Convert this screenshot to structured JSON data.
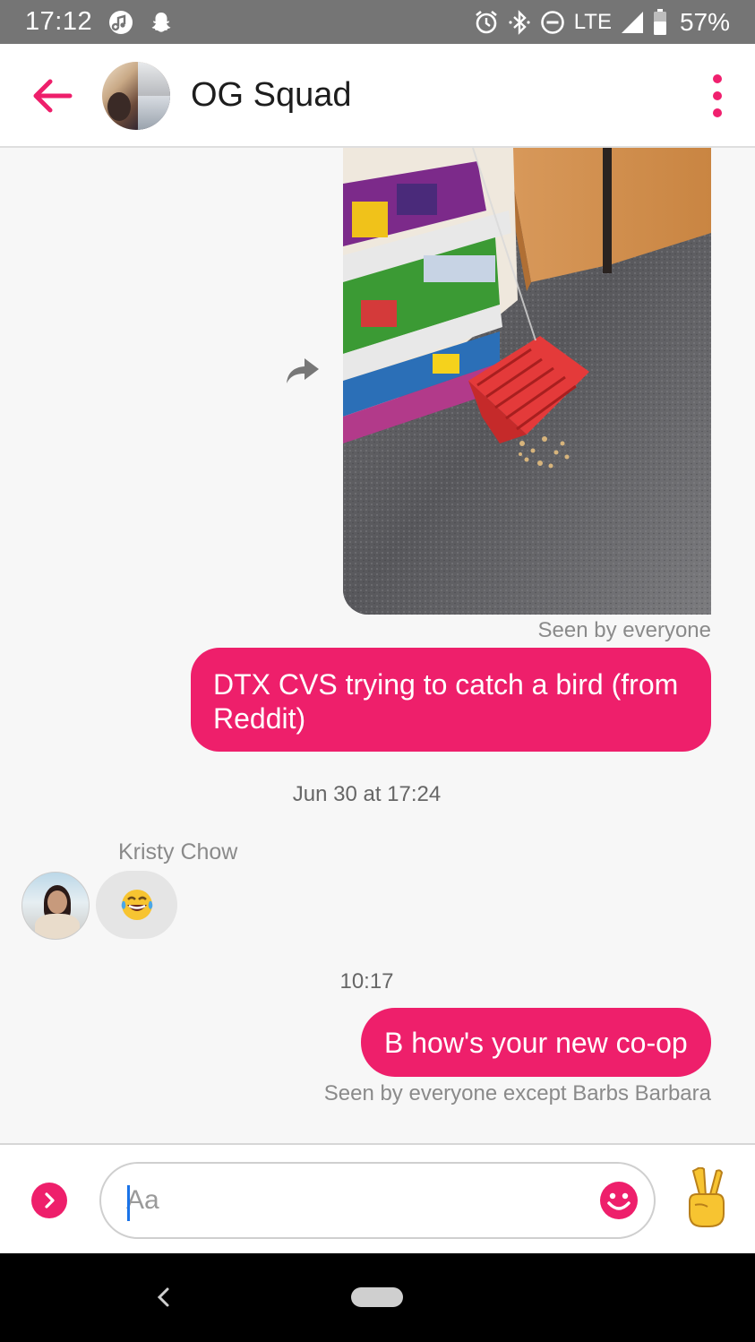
{
  "status_bar": {
    "time": "17:12",
    "network": "LTE",
    "battery": "57%",
    "icons": [
      "music-icon",
      "snapchat-icon",
      "alarm-icon",
      "bluetooth-icon",
      "do-not-disturb-icon",
      "signal-icon",
      "battery-icon"
    ]
  },
  "header": {
    "title": "OG Squad",
    "back_icon": "arrow-left-icon",
    "menu_icon": "more-vertical-icon"
  },
  "messages": {
    "photo_seen": "Seen by everyone",
    "bubble1": "DTX CVS trying to catch a bird (from Reddit)",
    "timestamp1": "Jun 30 at 17:24",
    "sender_name": "Kristy Chow",
    "emoji_reaction": "😂",
    "timestamp2": "10:17",
    "bubble2": "B how's your new co-op",
    "seen2": "Seen by everyone except Barbs Barbara"
  },
  "composer": {
    "placeholder": "Aa",
    "value": ""
  },
  "colors": {
    "accent": "#ee1f6b",
    "status_bar": "#757575",
    "background": "#f7f7f7"
  }
}
